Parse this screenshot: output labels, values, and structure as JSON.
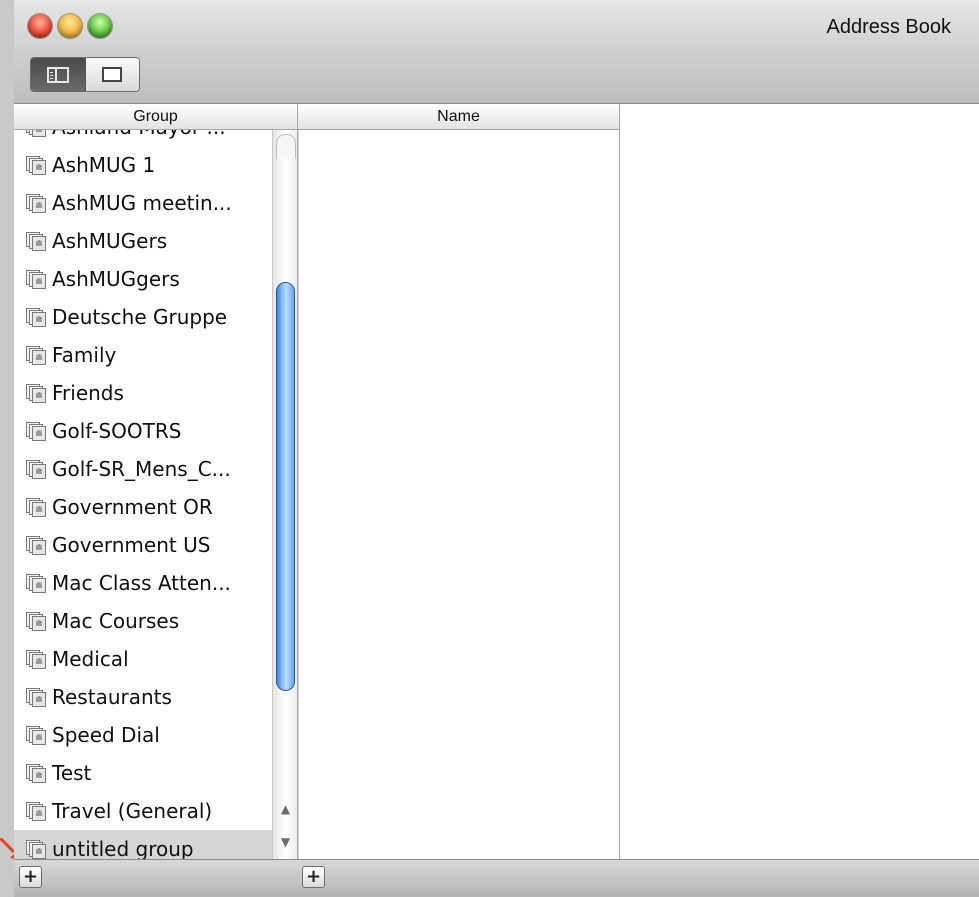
{
  "window": {
    "title": "Address Book"
  },
  "toolbar": {
    "view_buttons": [
      {
        "icon": "column-view-icon",
        "active": true
      },
      {
        "icon": "card-view-icon",
        "active": false
      }
    ]
  },
  "columns": {
    "group_header": "Group",
    "name_header": "Name"
  },
  "groups": {
    "items": [
      {
        "label": "Ashland Mayor ...",
        "selected": false
      },
      {
        "label": "AshMUG 1",
        "selected": false
      },
      {
        "label": "AshMUG meetin...",
        "selected": false
      },
      {
        "label": "AshMUGers",
        "selected": false
      },
      {
        "label": "AshMUGgers",
        "selected": false
      },
      {
        "label": "Deutsche Gruppe",
        "selected": false
      },
      {
        "label": "Family",
        "selected": false
      },
      {
        "label": "Friends",
        "selected": false
      },
      {
        "label": "Golf-SOOTRS",
        "selected": false
      },
      {
        "label": "Golf-SR_Mens_C...",
        "selected": false
      },
      {
        "label": "Government OR",
        "selected": false
      },
      {
        "label": "Government US",
        "selected": false
      },
      {
        "label": "Mac Class Atten...",
        "selected": false
      },
      {
        "label": "Mac Courses",
        "selected": false
      },
      {
        "label": "Medical",
        "selected": false
      },
      {
        "label": "Restaurants",
        "selected": false
      },
      {
        "label": "Speed Dial",
        "selected": false
      },
      {
        "label": "Test",
        "selected": false
      },
      {
        "label": "Travel (General)",
        "selected": false
      },
      {
        "label": "untitled group",
        "selected": true
      }
    ]
  },
  "bottom_bar": {
    "add_group_label": "+",
    "add_name_label": "+"
  },
  "colors": {
    "accent_red_arrow": "#e8411c",
    "scroll_thumb": "#5d9ae8",
    "selection": "#d6d6d6"
  }
}
